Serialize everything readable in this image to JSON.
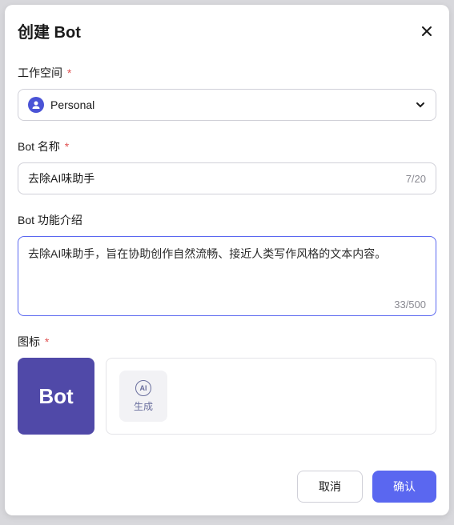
{
  "modal": {
    "title": "创建 Bot"
  },
  "workspace": {
    "label": "工作空间",
    "value": "Personal"
  },
  "botName": {
    "label": "Bot 名称",
    "value": "去除AI味助手",
    "count": "7/20"
  },
  "description": {
    "label": "Bot 功能介绍",
    "value": "去除AI味助手，旨在协助创作自然流畅、接近人类写作风格的文本内容。",
    "count": "33/500"
  },
  "icon": {
    "label": "图标",
    "previewText": "Bot",
    "aiLabel": "AI",
    "generateLabel": "生成"
  },
  "footer": {
    "cancel": "取消",
    "confirm": "确认"
  }
}
